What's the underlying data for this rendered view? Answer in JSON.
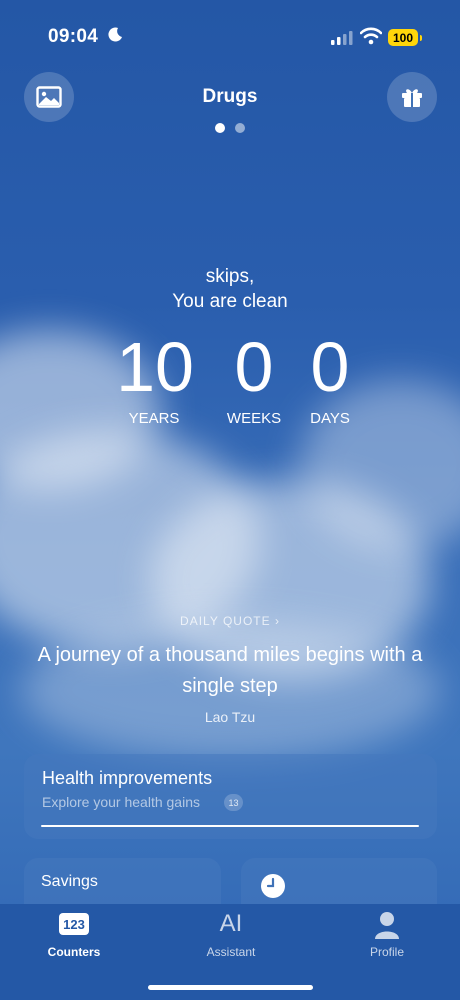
{
  "status_bar": {
    "time": "09:04",
    "battery": "100"
  },
  "header": {
    "title": "Drugs"
  },
  "greeting": {
    "line1": "skips,",
    "line2": "You are clean"
  },
  "counter": {
    "years": {
      "value": "10",
      "label": "YEARS"
    },
    "weeks": {
      "value": "0",
      "label": "WEEKS"
    },
    "days": {
      "value": "0",
      "label": "DAYS"
    }
  },
  "quote": {
    "label": "DAILY QUOTE",
    "text": "A journey of a thousand miles begins with a single step",
    "author": "Lao Tzu"
  },
  "health_card": {
    "title": "Health improvements",
    "subtitle": "Explore your health gains",
    "badge": "13"
  },
  "savings_card": {
    "title": "Savings"
  },
  "tabs": [
    {
      "label": "Counters",
      "icon_text": "123"
    },
    {
      "label": "Assistant",
      "icon_text": "AI"
    },
    {
      "label": "Profile"
    }
  ],
  "colors": {
    "background": "#2a5eae",
    "battery": "#ffd60a"
  }
}
